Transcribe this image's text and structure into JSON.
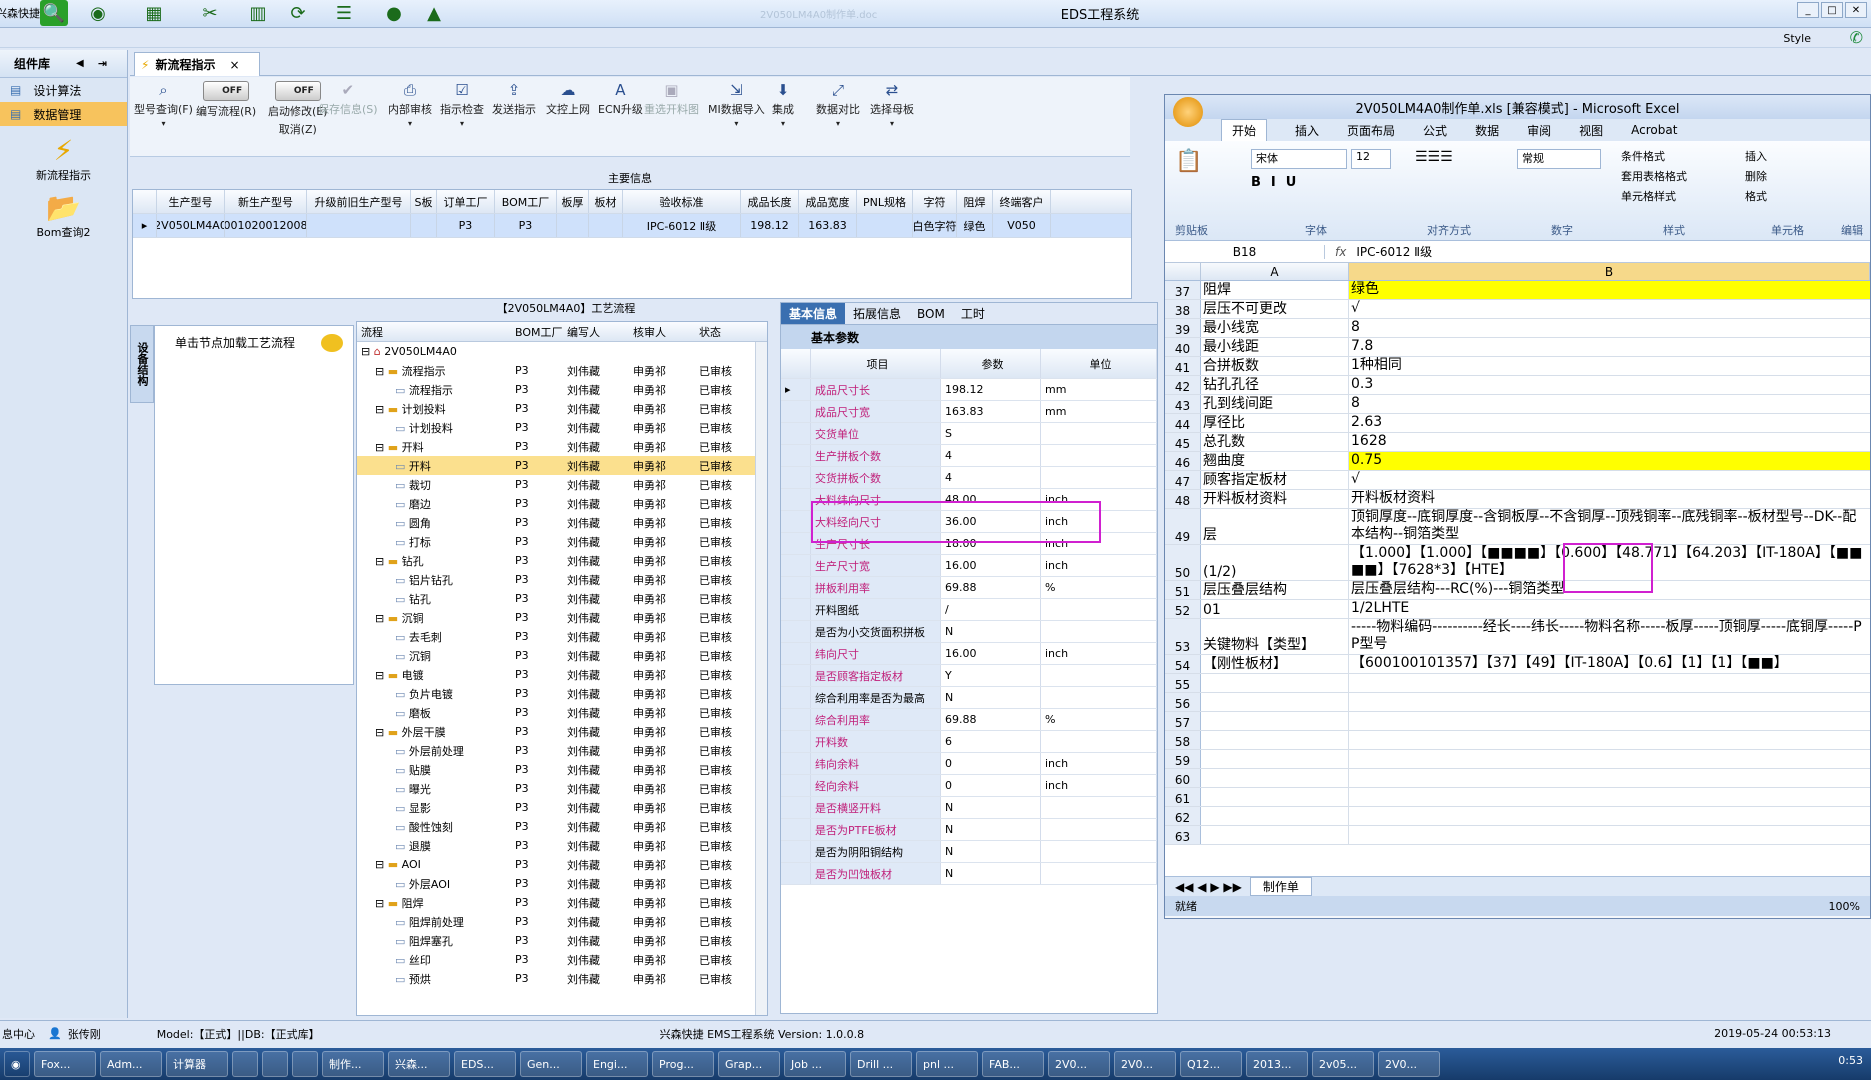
{
  "app": {
    "title": "EDS工程系统",
    "brand": "兴森快捷",
    "faint_doc": "2V050LM4A0制作单.doc",
    "style_label": "Style",
    "toolbar_icons": [
      "search-icon",
      "globe-icon",
      "grid-icon",
      "scissors-icon",
      "table-icon",
      "refresh-icon",
      "list-icon",
      "user-icon",
      "chart-icon"
    ]
  },
  "left": {
    "header": "组件库",
    "items": [
      {
        "label": "设计算法"
      },
      {
        "label": "数据管理"
      }
    ],
    "big": [
      {
        "label": "新流程指示"
      },
      {
        "label": "Bom查询2"
      }
    ]
  },
  "tab": {
    "label": "新流程指示",
    "close": "×"
  },
  "ribbon": {
    "buttons": [
      {
        "label": "型号查询(F)",
        "icon": "search-icon"
      },
      {
        "label": "编写流程(R)",
        "icon": "toggle"
      },
      {
        "label": "启动修改(E)",
        "sub": "取消(Z)",
        "icon": "toggle"
      },
      {
        "label": "保存信息(S)",
        "icon": "check-icon",
        "dim": true
      },
      {
        "label": "内部审核",
        "icon": "print-icon"
      },
      {
        "label": "指示检查",
        "icon": "check-icon"
      },
      {
        "label": "发送指示",
        "icon": "upload-icon"
      },
      {
        "label": "文控上网",
        "icon": "cloud-icon"
      },
      {
        "label": "ECN升级",
        "icon": "a-icon"
      },
      {
        "label": "重选开料图",
        "icon": "image-icon",
        "dim": true
      },
      {
        "label": "MI数据导入",
        "icon": "import-icon"
      },
      {
        "label": "集成",
        "icon": "download-icon"
      },
      {
        "label": "数据对比",
        "icon": "compare-icon"
      },
      {
        "label": "选择母板",
        "icon": "shuffle-icon"
      }
    ],
    "toggle_text": "OFF"
  },
  "main": {
    "section_label": "主要信息",
    "columns": [
      "生产型号",
      "新生产型号",
      "升级前旧生产型号",
      "S板",
      "订单工厂",
      "BOM工厂",
      "板厚",
      "板材",
      "验收标准",
      "成品长度",
      "成品宽度",
      "PNL规格",
      "字符",
      "阻焊",
      "终端客户"
    ],
    "rows": [
      [
        "2V050LM4A0",
        "10010200120088",
        "",
        "",
        "P3",
        "P3",
        "",
        "",
        "IPC-6012 Ⅱ级",
        "198.12",
        "163.83",
        "",
        "白色字符",
        "绿色",
        "V050"
      ]
    ]
  },
  "process": {
    "vtab": "设备结构",
    "hint": "单击节点加载工艺流程",
    "header": "【2V050LM4A0】工艺流程",
    "columns": [
      "流程",
      "BOM工厂",
      "编写人",
      "核审人",
      "状态"
    ],
    "root": "2V050LM4A0",
    "rows": [
      {
        "level": 1,
        "folder": true,
        "name": "流程指示",
        "f": "P3",
        "w": "刘伟藏",
        "r": "申勇祁",
        "s": "已审核"
      },
      {
        "level": 2,
        "folder": false,
        "name": "流程指示",
        "f": "P3",
        "w": "刘伟藏",
        "r": "申勇祁",
        "s": "已审核"
      },
      {
        "level": 1,
        "folder": true,
        "name": "计划投料",
        "f": "P3",
        "w": "刘伟藏",
        "r": "申勇祁",
        "s": "已审核"
      },
      {
        "level": 2,
        "folder": false,
        "name": "计划投料",
        "f": "P3",
        "w": "刘伟藏",
        "r": "申勇祁",
        "s": "已审核"
      },
      {
        "level": 1,
        "folder": true,
        "name": "开料",
        "f": "P3",
        "w": "刘伟藏",
        "r": "申勇祁",
        "s": "已审核"
      },
      {
        "level": 2,
        "folder": false,
        "name": "开料",
        "f": "P3",
        "w": "刘伟藏",
        "r": "申勇祁",
        "s": "已审核",
        "sel": true
      },
      {
        "level": 2,
        "folder": false,
        "name": "裁切",
        "f": "P3",
        "w": "刘伟藏",
        "r": "申勇祁",
        "s": "已审核"
      },
      {
        "level": 2,
        "folder": false,
        "name": "磨边",
        "f": "P3",
        "w": "刘伟藏",
        "r": "申勇祁",
        "s": "已审核"
      },
      {
        "level": 2,
        "folder": false,
        "name": "圆角",
        "f": "P3",
        "w": "刘伟藏",
        "r": "申勇祁",
        "s": "已审核"
      },
      {
        "level": 2,
        "folder": false,
        "name": "打标",
        "f": "P3",
        "w": "刘伟藏",
        "r": "申勇祁",
        "s": "已审核"
      },
      {
        "level": 1,
        "folder": true,
        "name": "钻孔",
        "f": "P3",
        "w": "刘伟藏",
        "r": "申勇祁",
        "s": "已审核"
      },
      {
        "level": 2,
        "folder": false,
        "name": "铝片钻孔",
        "f": "P3",
        "w": "刘伟藏",
        "r": "申勇祁",
        "s": "已审核"
      },
      {
        "level": 2,
        "folder": false,
        "name": "钻孔",
        "f": "P3",
        "w": "刘伟藏",
        "r": "申勇祁",
        "s": "已审核"
      },
      {
        "level": 1,
        "folder": true,
        "name": "沉铜",
        "f": "P3",
        "w": "刘伟藏",
        "r": "申勇祁",
        "s": "已审核"
      },
      {
        "level": 2,
        "folder": false,
        "name": "去毛刺",
        "f": "P3",
        "w": "刘伟藏",
        "r": "申勇祁",
        "s": "已审核"
      },
      {
        "level": 2,
        "folder": false,
        "name": "沉铜",
        "f": "P3",
        "w": "刘伟藏",
        "r": "申勇祁",
        "s": "已审核"
      },
      {
        "level": 1,
        "folder": true,
        "name": "电镀",
        "f": "P3",
        "w": "刘伟藏",
        "r": "申勇祁",
        "s": "已审核"
      },
      {
        "level": 2,
        "folder": false,
        "name": "负片电镀",
        "f": "P3",
        "w": "刘伟藏",
        "r": "申勇祁",
        "s": "已审核"
      },
      {
        "level": 2,
        "folder": false,
        "name": "磨板",
        "f": "P3",
        "w": "刘伟藏",
        "r": "申勇祁",
        "s": "已审核"
      },
      {
        "level": 1,
        "folder": true,
        "name": "外层干膜",
        "f": "P3",
        "w": "刘伟藏",
        "r": "申勇祁",
        "s": "已审核"
      },
      {
        "level": 2,
        "folder": false,
        "name": "外层前处理",
        "f": "P3",
        "w": "刘伟藏",
        "r": "申勇祁",
        "s": "已审核"
      },
      {
        "level": 2,
        "folder": false,
        "name": "贴膜",
        "f": "P3",
        "w": "刘伟藏",
        "r": "申勇祁",
        "s": "已审核"
      },
      {
        "level": 2,
        "folder": false,
        "name": "曝光",
        "f": "P3",
        "w": "刘伟藏",
        "r": "申勇祁",
        "s": "已审核"
      },
      {
        "level": 2,
        "folder": false,
        "name": "显影",
        "f": "P3",
        "w": "刘伟藏",
        "r": "申勇祁",
        "s": "已审核"
      },
      {
        "level": 2,
        "folder": false,
        "name": "酸性蚀刻",
        "f": "P3",
        "w": "刘伟藏",
        "r": "申勇祁",
        "s": "已审核"
      },
      {
        "level": 2,
        "folder": false,
        "name": "退膜",
        "f": "P3",
        "w": "刘伟藏",
        "r": "申勇祁",
        "s": "已审核"
      },
      {
        "level": 1,
        "folder": true,
        "name": "AOI",
        "f": "P3",
        "w": "刘伟藏",
        "r": "申勇祁",
        "s": "已审核"
      },
      {
        "level": 2,
        "folder": false,
        "name": "外层AOI",
        "f": "P3",
        "w": "刘伟藏",
        "r": "申勇祁",
        "s": "已审核"
      },
      {
        "level": 1,
        "folder": true,
        "name": "阻焊",
        "f": "P3",
        "w": "刘伟藏",
        "r": "申勇祁",
        "s": "已审核"
      },
      {
        "level": 2,
        "folder": false,
        "name": "阻焊前处理",
        "f": "P3",
        "w": "刘伟藏",
        "r": "申勇祁",
        "s": "已审核"
      },
      {
        "level": 2,
        "folder": false,
        "name": "阻焊塞孔",
        "f": "P3",
        "w": "刘伟藏",
        "r": "申勇祁",
        "s": "已审核"
      },
      {
        "level": 2,
        "folder": false,
        "name": "丝印",
        "f": "P3",
        "w": "刘伟藏",
        "r": "申勇祁",
        "s": "已审核"
      },
      {
        "level": 2,
        "folder": false,
        "name": "预烘",
        "f": "P3",
        "w": "刘伟藏",
        "r": "申勇祁",
        "s": "已审核"
      }
    ]
  },
  "basic": {
    "tabs": [
      "基本信息",
      "拓展信息",
      "BOM",
      "工时"
    ],
    "section": "基本参数",
    "columns": [
      "项目",
      "参数",
      "单位"
    ],
    "rows": [
      {
        "k": "成品尺寸长",
        "v": "198.12",
        "u": "mm",
        "pink": true
      },
      {
        "k": "成品尺寸宽",
        "v": "163.83",
        "u": "mm",
        "pink": true
      },
      {
        "k": "交货单位",
        "v": "S",
        "u": "",
        "pink": true
      },
      {
        "k": "生产拼板个数",
        "v": "4",
        "u": "",
        "pink": true
      },
      {
        "k": "交货拼板个数",
        "v": "4",
        "u": "",
        "pink": true
      },
      {
        "k": "大料纬向尺寸",
        "v": "48.00",
        "u": "inch",
        "pink": true
      },
      {
        "k": "大料经向尺寸",
        "v": "36.00",
        "u": "inch",
        "pink": true
      },
      {
        "k": "生产尺寸长",
        "v": "18.00",
        "u": "inch",
        "pink": true
      },
      {
        "k": "生产尺寸宽",
        "v": "16.00",
        "u": "inch",
        "pink": true
      },
      {
        "k": "拼板利用率",
        "v": "69.88",
        "u": "%",
        "pink": true
      },
      {
        "k": "开料图纸",
        "v": "/",
        "u": "",
        "pink": false
      },
      {
        "k": "是否为小交货面积拼板",
        "v": "N",
        "u": "",
        "pink": false
      },
      {
        "k": "纬向尺寸",
        "v": "16.00",
        "u": "inch",
        "pink": true
      },
      {
        "k": "是否顾客指定板材",
        "v": "Y",
        "u": "",
        "pink": true
      },
      {
        "k": "综合利用率是否为最高",
        "v": "N",
        "u": "",
        "pink": false
      },
      {
        "k": "综合利用率",
        "v": "69.88",
        "u": "%",
        "pink": true
      },
      {
        "k": "开料数",
        "v": "6",
        "u": "",
        "pink": true
      },
      {
        "k": "纬向余料",
        "v": "0",
        "u": "inch",
        "pink": true
      },
      {
        "k": "经向余料",
        "v": "0",
        "u": "inch",
        "pink": true
      },
      {
        "k": "是否横竖开料",
        "v": "N",
        "u": "",
        "pink": true
      },
      {
        "k": "是否为PTFE板材",
        "v": "N",
        "u": "",
        "pink": true
      },
      {
        "k": "是否为阴阳铜结构",
        "v": "N",
        "u": "",
        "pink": false
      },
      {
        "k": "是否为凹蚀板材",
        "v": "N",
        "u": "",
        "pink": true
      }
    ]
  },
  "excel": {
    "title": "2V050LM4A0制作单.xls [兼容模式] - Microsoft Excel",
    "tabs": [
      "开始",
      "插入",
      "页面布局",
      "公式",
      "数据",
      "审阅",
      "视图",
      "Acrobat"
    ],
    "groups": [
      "剪贴板",
      "字体",
      "对齐方式",
      "数字",
      "样式",
      "单元格",
      "编辑"
    ],
    "font": "宋体",
    "size": "12",
    "numfmt": "常规",
    "style_btns": [
      "条件格式",
      "套用表格格式",
      "单元格样式"
    ],
    "cell_btns": [
      "插入",
      "删除",
      "格式"
    ],
    "namebox": "B18",
    "fx": "fx",
    "formula": "IPC-6012 Ⅱ级",
    "cols": [
      "A",
      "B"
    ],
    "rows": [
      {
        "n": "37",
        "a": "阻焊",
        "b": "绿色",
        "yellow": true
      },
      {
        "n": "38",
        "a": "层压不可更改",
        "b": "√"
      },
      {
        "n": "39",
        "a": "最小线宽",
        "b": "8"
      },
      {
        "n": "40",
        "a": "最小线距",
        "b": "7.8"
      },
      {
        "n": "41",
        "a": "合拼板数",
        "b": "1种相同"
      },
      {
        "n": "42",
        "a": "钻孔孔径",
        "b": "0.3"
      },
      {
        "n": "43",
        "a": "孔到线间距",
        "b": "8"
      },
      {
        "n": "44",
        "a": "厚径比",
        "b": "2.63"
      },
      {
        "n": "45",
        "a": "总孔数",
        "b": "1628"
      },
      {
        "n": "46",
        "a": "翘曲度",
        "b": "0.75",
        "yellow": true
      },
      {
        "n": "47",
        "a": "顾客指定板材",
        "b": "√"
      },
      {
        "n": "48",
        "a": "开料板材资料",
        "b": "开料板材资料"
      },
      {
        "n": "49",
        "a": "层",
        "b": "顶铜厚度--底铜厚度--含铜板厚--不含铜厚--顶残铜率--底残铜率--板材型号--DK--配本结构--铜箔类型",
        "tall": true
      },
      {
        "n": "50",
        "a": "(1/2)",
        "b": "【1.000】【1.000】【■■■■】【0.600】【48.771】【64.203】【IT-180A】【■■■■】【7628*3】【HTE】",
        "tall": true
      },
      {
        "n": "51",
        "a": "层压叠层结构",
        "b": "层压叠层结构---RC(%)---铜箔类型"
      },
      {
        "n": "52",
        "a": "01",
        "b": "1/2LHTE"
      },
      {
        "n": "53",
        "a": "关键物料【类型】",
        "b": "-----物料编码----------经长----纬长-----物料名称-----板厚-----顶铜厚-----底铜厚-----PP型号",
        "tall": true
      },
      {
        "n": "54",
        "a": "【刚性板材】",
        "b": "【600100101357】【37】【49】【IT-180A】【0.6】【1】【1】【■■】"
      },
      {
        "n": "55",
        "a": "",
        "b": ""
      },
      {
        "n": "56",
        "a": "",
        "b": ""
      },
      {
        "n": "57",
        "a": "",
        "b": ""
      },
      {
        "n": "58",
        "a": "",
        "b": ""
      },
      {
        "n": "59",
        "a": "",
        "b": ""
      },
      {
        "n": "60",
        "a": "",
        "b": ""
      },
      {
        "n": "61",
        "a": "",
        "b": ""
      },
      {
        "n": "62",
        "a": "",
        "b": ""
      },
      {
        "n": "63",
        "a": "",
        "b": ""
      }
    ],
    "sheet": "制作单",
    "status_left": "就绪",
    "zoom": "100%"
  },
  "status": {
    "left": "息中心",
    "user": "张传刚",
    "model": "Model:【正式】||DB:【正式库】",
    "center": "兴森快捷 EMS工程系统 Version: 1.0.0.8",
    "time": "2019-05-24 00:53:13"
  },
  "taskbar": {
    "items": [
      "Fox...",
      "Adm...",
      "计算器",
      "",
      "",
      "",
      "制作...",
      "兴森...",
      "EDS...",
      "Gen...",
      "Engi...",
      "Prog...",
      "Grap...",
      "Job ...",
      "Drill ...",
      "pnl ...",
      "FAB...",
      "2V0...",
      "2V0...",
      "Q12...",
      "2013...",
      "2v05...",
      "2V0..."
    ],
    "clock": "0:53"
  }
}
